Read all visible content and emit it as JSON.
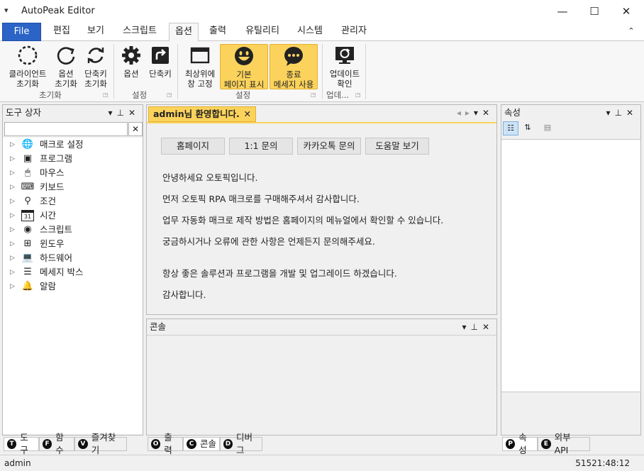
{
  "window": {
    "title": "AutoPeak Editor",
    "qa_icon": "quick-access-dropdown",
    "minimize": "—",
    "maximize": "☐",
    "close": "✕"
  },
  "tabs": [
    "File",
    "편집",
    "보기",
    "스크립트",
    "옵션",
    "출력",
    "유틸리티",
    "시스템",
    "관리자"
  ],
  "active_tab": "옵션",
  "ribbon": {
    "groups": [
      {
        "label": "초기화",
        "buttons": [
          {
            "line1": "클라이언트",
            "line2": "초기화",
            "icon": "dashed-circle-icon"
          },
          {
            "line1": "옵션",
            "line2": "초기화",
            "icon": "refresh-icon"
          },
          {
            "line1": "단축키",
            "line2": "초기화",
            "icon": "sync-icon"
          }
        ]
      },
      {
        "label": "설정",
        "buttons": [
          {
            "line1": "옵션",
            "line2": "",
            "icon": "gear-icon"
          },
          {
            "line1": "단축키",
            "line2": "",
            "icon": "shortcut-icon"
          }
        ]
      },
      {
        "label": "설정",
        "buttons": [
          {
            "line1": "최상위에",
            "line2": "창 고정",
            "icon": "window-icon"
          },
          {
            "line1": "기본",
            "line2": "페이지 표시",
            "icon": "smiley-icon"
          },
          {
            "line1": "종료",
            "line2": "메세지 사용",
            "icon": "chat-bubble-icon"
          }
        ]
      },
      {
        "label": "업데...",
        "buttons": [
          {
            "line1": "업데이트",
            "line2": "확인",
            "icon": "monitor-refresh-icon"
          }
        ]
      }
    ]
  },
  "toolbox": {
    "title": "도구 상자",
    "search_placeholder": "",
    "clear": "✕",
    "items": [
      {
        "label": "매크로 설정",
        "icon": "globe-icon",
        "glyph": "🌐"
      },
      {
        "label": "프로그램",
        "icon": "cursor-icon",
        "glyph": "▣"
      },
      {
        "label": "마우스",
        "icon": "mouse-icon",
        "glyph": "🖱"
      },
      {
        "label": "키보드",
        "icon": "keyboard-icon",
        "glyph": "⌨"
      },
      {
        "label": "조건",
        "icon": "condition-icon",
        "glyph": "⚲"
      },
      {
        "label": "시간",
        "icon": "calendar-icon",
        "glyph": "31"
      },
      {
        "label": "스크립트",
        "icon": "script-icon",
        "glyph": "◉"
      },
      {
        "label": "윈도우",
        "icon": "windows-icon",
        "glyph": "⊞"
      },
      {
        "label": "하드웨어",
        "icon": "laptop-icon",
        "glyph": "💻"
      },
      {
        "label": "메세지 박스",
        "icon": "message-box-icon",
        "glyph": "☰"
      },
      {
        "label": "알람",
        "icon": "bell-icon",
        "glyph": "🔔"
      }
    ],
    "bottom_tabs": [
      {
        "key": "T",
        "label": "도구"
      },
      {
        "key": "F",
        "label": "함수"
      },
      {
        "key": "V",
        "label": "즐겨찾기"
      }
    ]
  },
  "doc": {
    "tab_title": "admin님 환영합니다.",
    "buttons": [
      "홈페이지",
      "1:1 문의",
      "카카오톡 문의",
      "도움말 보기"
    ],
    "lines": [
      "안녕하세요 오토픽입니다.",
      "먼저 오토픽 RPA 매크로를 구매해주셔서 감사합니다.",
      "업무 자동화 매크로 제작 방법은 홈페이지의 메뉴얼에서 확인할 수 있습니다.",
      "궁금하시거나 오류에 관한 사항은 언제든지 문의해주세요.",
      "항상 좋은 솔루션과 프로그램을 개발 및 업그레이드 하겠습니다.",
      "감사합니다."
    ]
  },
  "console": {
    "title": "콘솔",
    "bottom_tabs": [
      {
        "key": "O",
        "label": "출력"
      },
      {
        "key": "C",
        "label": "콘솔"
      },
      {
        "key": "D",
        "label": "디버그"
      }
    ]
  },
  "properties": {
    "title": "속성",
    "bottom_tabs": [
      {
        "key": "P",
        "label": "속성"
      },
      {
        "key": "E",
        "label": "외부 API"
      }
    ]
  },
  "status": {
    "user": "admin",
    "time": "51521:48:12"
  },
  "colors": {
    "file_tab": "#2b63c6",
    "highlight": "#fbd35c"
  }
}
